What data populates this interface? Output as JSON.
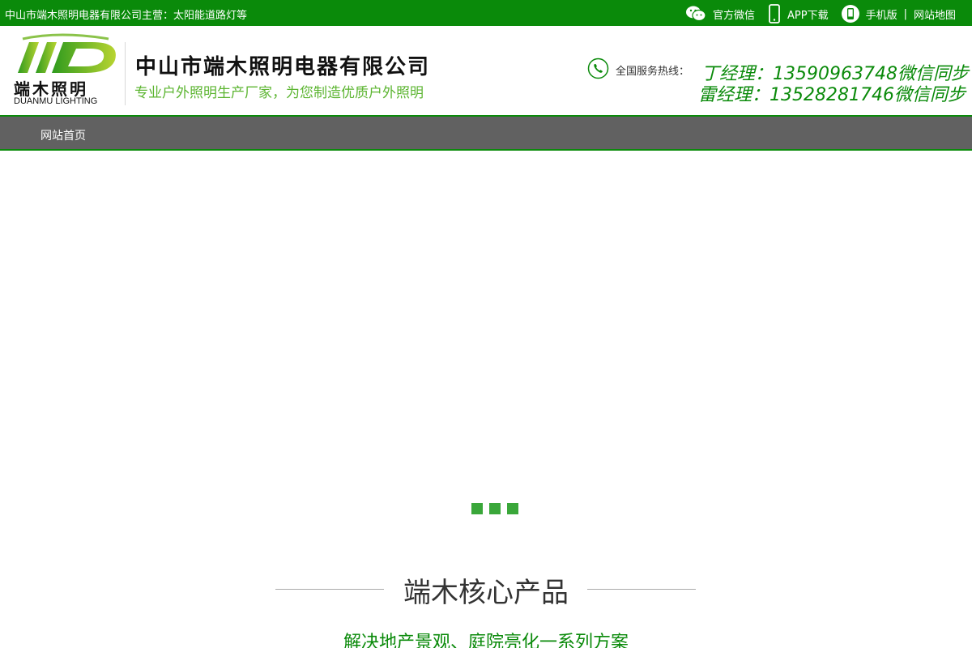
{
  "topbar": {
    "slogan": "中山市端木照明电器有限公司主营：太阳能道路灯等",
    "wechat": "官方微信",
    "app": "APP下载",
    "mobile": "手机版",
    "separator": "|",
    "sitemap": "网站地图"
  },
  "header": {
    "logo_cn": "端木照明",
    "logo_en": "DUANMU LIGHTING",
    "company_name": "中山市端木照明电器有限公司",
    "tagline": "专业户外照明生产厂家，为您制造优质户外照明",
    "hotline_label": "全国服务热线：",
    "phones": [
      "丁经理：13590963748微信同步",
      "雷经理：13528281746微信同步"
    ]
  },
  "nav": {
    "items": [
      "网站首页"
    ]
  },
  "banner": {
    "slide_count": 3
  },
  "section": {
    "title": "端木核心产品",
    "subtitle": "解决地产景观、庭院亮化一系列方案"
  },
  "colors": {
    "brand_green": "#0a8a0a",
    "accent_green": "#5cb531",
    "nav_gray": "#616161"
  },
  "icons": [
    "wechat-icon",
    "phone-app-icon",
    "mobile-icon",
    "hotline-phone-icon"
  ]
}
